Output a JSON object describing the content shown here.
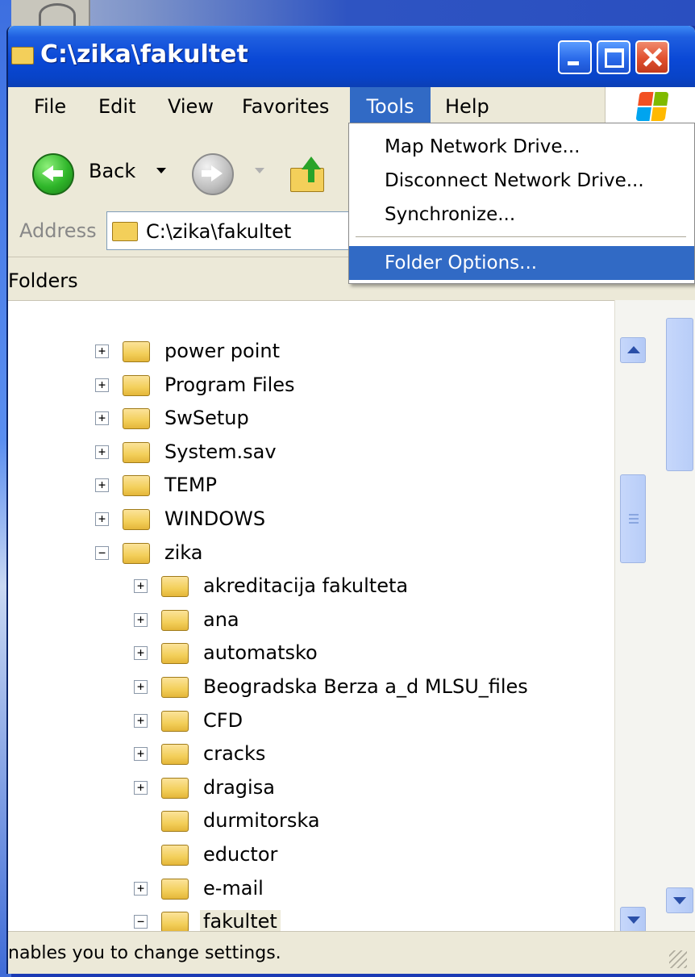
{
  "window": {
    "title": "C:\\zika\\fakultet"
  },
  "menubar": {
    "items": [
      "File",
      "Edit",
      "View",
      "Favorites",
      "Tools",
      "Help"
    ],
    "active": "Tools"
  },
  "toolbar": {
    "back_label": "Back"
  },
  "address": {
    "label": "Address",
    "value": "C:\\zika\\fakultet"
  },
  "folders_pane": {
    "title": "Folders",
    "items": [
      {
        "label": "power point",
        "toggle": "+",
        "level": 1
      },
      {
        "label": "Program Files",
        "toggle": "+",
        "level": 1
      },
      {
        "label": "SwSetup",
        "toggle": "+",
        "level": 1
      },
      {
        "label": "System.sav",
        "toggle": "+",
        "level": 1
      },
      {
        "label": "TEMP",
        "toggle": "+",
        "level": 1
      },
      {
        "label": "WINDOWS",
        "toggle": "+",
        "level": 1
      },
      {
        "label": "zika",
        "toggle": "−",
        "level": 1
      },
      {
        "label": "akreditacija fakulteta",
        "toggle": "+",
        "level": 2
      },
      {
        "label": "ana",
        "toggle": "+",
        "level": 2
      },
      {
        "label": "automatsko",
        "toggle": "+",
        "level": 2
      },
      {
        "label": "Beogradska Berza a_d MLSU_files",
        "toggle": "+",
        "level": 2
      },
      {
        "label": "CFD",
        "toggle": "+",
        "level": 2
      },
      {
        "label": "cracks",
        "toggle": "+",
        "level": 2
      },
      {
        "label": "dragisa",
        "toggle": "+",
        "level": 2
      },
      {
        "label": "durmitorska",
        "toggle": "",
        "level": 2
      },
      {
        "label": "eductor",
        "toggle": "",
        "level": 2
      },
      {
        "label": "e-mail",
        "toggle": "+",
        "level": 2
      },
      {
        "label": "fakultet",
        "toggle": "−",
        "level": 2,
        "selected": true
      }
    ]
  },
  "tools_menu": {
    "items": [
      "Map Network Drive...",
      "Disconnect Network Drive...",
      "Synchronize..."
    ],
    "highlighted": "Folder Options..."
  },
  "statusbar": {
    "text": "nables you to change settings."
  },
  "colors": {
    "title_bar": "#0a48d6",
    "menu_highlight": "#316ac5",
    "window_face": "#ece9d8",
    "folder_yellow": "#f3cf5a"
  }
}
